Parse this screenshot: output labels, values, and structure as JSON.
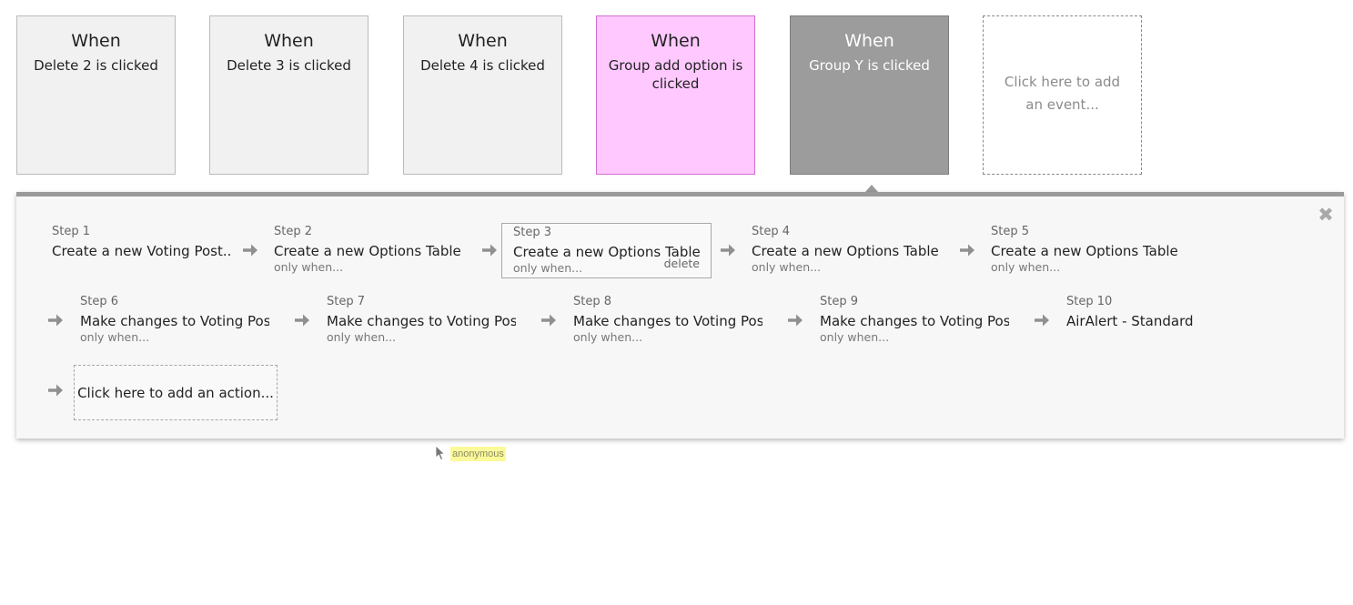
{
  "events": [
    {
      "when": "When",
      "desc": "Delete 2 is clicked"
    },
    {
      "when": "When",
      "desc": "Delete 3 is clicked"
    },
    {
      "when": "When",
      "desc": "Delete 4 is clicked"
    },
    {
      "when": "When",
      "desc": "Group add option is clicked"
    },
    {
      "when": "When",
      "desc": "Group Y is clicked"
    }
  ],
  "add_event_label": "Click here to add an event...",
  "close_symbol": "✖",
  "steps": [
    {
      "num": "Step 1",
      "title": "Create a new Voting Post...",
      "cond": ""
    },
    {
      "num": "Step 2",
      "title": "Create a new Options Table...",
      "cond": "only when..."
    },
    {
      "num": "Step 3",
      "title": "Create a new Options Table...",
      "cond": "only when...",
      "action": "delete"
    },
    {
      "num": "Step 4",
      "title": "Create a new Options Table...",
      "cond": "only when..."
    },
    {
      "num": "Step 5",
      "title": "Create a new Options Table...",
      "cond": "only when..."
    },
    {
      "num": "Step 6",
      "title": "Make changes to Voting Post...",
      "cond": "only when..."
    },
    {
      "num": "Step 7",
      "title": "Make changes to Voting Post...",
      "cond": "only when..."
    },
    {
      "num": "Step 8",
      "title": "Make changes to Voting Post...",
      "cond": "only when..."
    },
    {
      "num": "Step 9",
      "title": "Make changes to Voting Post...",
      "cond": "only when..."
    },
    {
      "num": "Step 10",
      "title": "AirAlert - Standard",
      "cond": ""
    }
  ],
  "add_action_label": "Click here to add an action...",
  "cursor_user": "anonymous",
  "colors": {
    "event_default": "#f0f1f0",
    "event_active": "#ffc9ff",
    "event_selected": "#9c9c9c",
    "panel_bar": "#9a9a9a",
    "user_tag": "#fcf99a"
  }
}
